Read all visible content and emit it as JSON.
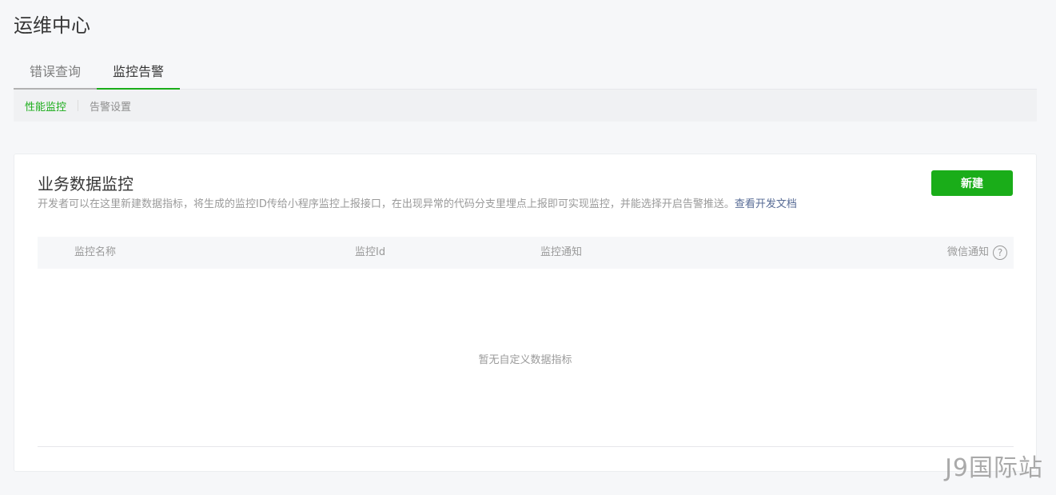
{
  "page": {
    "title": "运维中心"
  },
  "main_tabs": [
    {
      "label": "错误查询"
    },
    {
      "label": "监控告警"
    }
  ],
  "sub_tabs": [
    {
      "label": "性能监控"
    },
    {
      "label": "告警设置"
    }
  ],
  "card": {
    "title": "业务数据监控",
    "description": "开发者可以在这里新建数据指标，将生成的监控ID传给小程序监控上报接口，在出现异常的代码分支里埋点上报即可实现监控，并能选择开启告警推送。",
    "doc_link": "查看开发文档",
    "new_button": "新建"
  },
  "table": {
    "columns": [
      "监控名称",
      "监控Id",
      "监控通知",
      "微信通知"
    ],
    "help_icon": "question-circle-icon",
    "help_glyph": "?",
    "empty_text": "暂无自定义数据指标"
  },
  "watermark": "J9国际站",
  "colors": {
    "accent": "#1aad19",
    "link": "#576b95",
    "muted": "#9a9a9a"
  }
}
